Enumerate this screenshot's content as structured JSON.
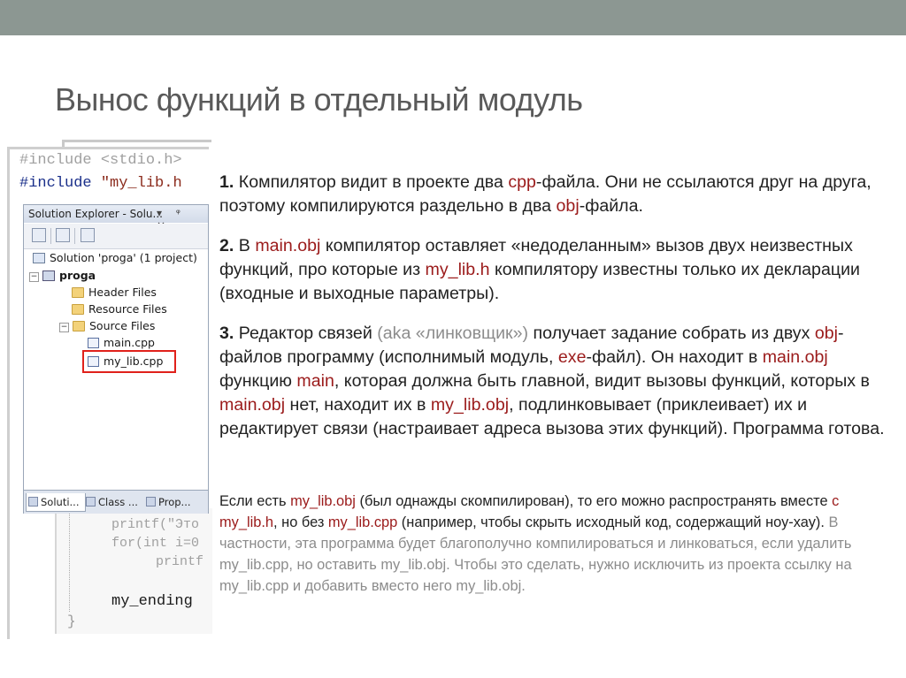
{
  "title": "Вынос функций в отдельный модуль",
  "code": {
    "line1": "#include <stdio.h>",
    "line2_prefix": "#include ",
    "line2_string": "\"my_lib.h",
    "bottom_lines": [
      "printf(\"Это",
      "for(int i=0",
      "printf",
      "my_ending"
    ],
    "brace": "}"
  },
  "solution_explorer": {
    "header": "Solution Explorer - Solu...",
    "header_buttons": "▾ ᵠ ×",
    "items": [
      {
        "label": "Solution 'proga' (1 project)"
      },
      {
        "label": "proga"
      },
      {
        "label": "Header Files"
      },
      {
        "label": "Resource Files"
      },
      {
        "label": "Source Files"
      },
      {
        "label": "main.cpp"
      },
      {
        "label": "my_lib.cpp"
      }
    ],
    "tabs": [
      "Soluti...",
      "Class ...",
      "Prop..."
    ]
  },
  "text": {
    "p1": {
      "num": "1.",
      "a": " Компилятор видит в проекте два ",
      "cpp": "cpp",
      "b": "-файла. Они не ссылаются друг на друга, поэтому компилируются раздельно в два ",
      "obj": "obj",
      "c": "-файла."
    },
    "p2": {
      "num": "2.",
      "a": " В ",
      "main_obj": "main.obj",
      "b": " компилятор оставляет «недоделанным» вызов двух неизвестных функций, про которые из ",
      "my_lib_h": "my_lib.h",
      "c": " компилятору известны только их декларации (входные и выходные параметры)."
    },
    "p3": {
      "num": "3.",
      "a": " Редактор связей ",
      "aka": "(aka «линковщик»)",
      "b": " получает задание собрать из двух ",
      "obj": "obj",
      "c": "-файлов программу (исполнимый модуль, ",
      "exe": "exe",
      "d": "-файл). Он находит в ",
      "main_obj": "main.obj",
      "e": " функцию ",
      "main": "main",
      "f": ", которая должна быть главной, видит вызовы функций, которых в ",
      "main_obj2": "main.obj",
      "g": " нет, находит их в ",
      "my_lib_obj": "my_lib.obj",
      "h": ", подлинковывает (приклеивает) их и редактирует связи (настраивает адреса вызова этих функций). Программа готова."
    },
    "p4": {
      "a": "Если есть ",
      "my_lib_obj": "my_lib.obj",
      "b": " (был однажды скомпилирован), то его можно распространять вместе ",
      "with_h": "с my_lib.h",
      "c": ", но без ",
      "my_lib_cpp": "my_lib.cpp",
      "d": " (например, чтобы скрыть исходный код, содержащий ноу-хау).",
      "gray": " В частности, эта программа будет благополучно компилироваться и линковаться, если удалить my_lib.cpp, но оставить my_lib.obj. Чтобы это сделать, нужно исключить из проекта ссылку на my_lib.cpp и добавить вместо него my_lib.obj."
    }
  },
  "colors": {
    "topbar": "#8c9792",
    "highlight": "#e0211b",
    "accent_red": "#9b1b1b"
  }
}
